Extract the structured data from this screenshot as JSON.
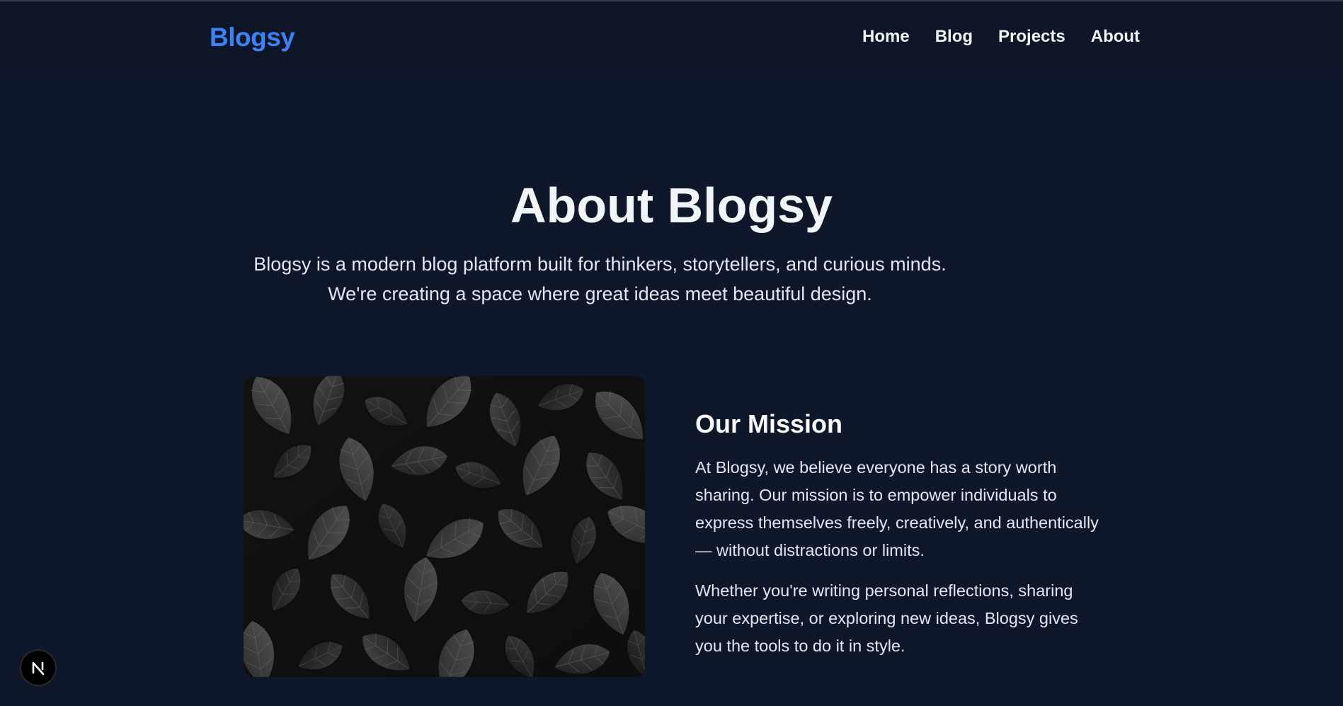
{
  "brand": "Blogsy",
  "nav": {
    "items": [
      {
        "label": "Home"
      },
      {
        "label": "Blog"
      },
      {
        "label": "Projects"
      },
      {
        "label": "About"
      }
    ]
  },
  "hero": {
    "title": "About Blogsy",
    "line1": "Blogsy is a modern blog platform built for thinkers, storytellers, and curious minds.",
    "line2": "We're creating a space where great ideas meet beautiful design."
  },
  "mission": {
    "title": "Our Mission",
    "paragraph1": "At Blogsy, we believe everyone has a story worth sharing. Our mission is to empower individuals to express themselves freely, creatively, and authentically — without distractions or limits.",
    "paragraph2": "Whether you're writing personal reflections, sharing your expertise, or exploring new ideas, Blogsy gives you the tools to do it in style."
  },
  "badge_icon": "nextjs-n-icon",
  "colors": {
    "background": "#0f172a",
    "brand": "#3b82f6",
    "text": "#f1f5f9"
  }
}
